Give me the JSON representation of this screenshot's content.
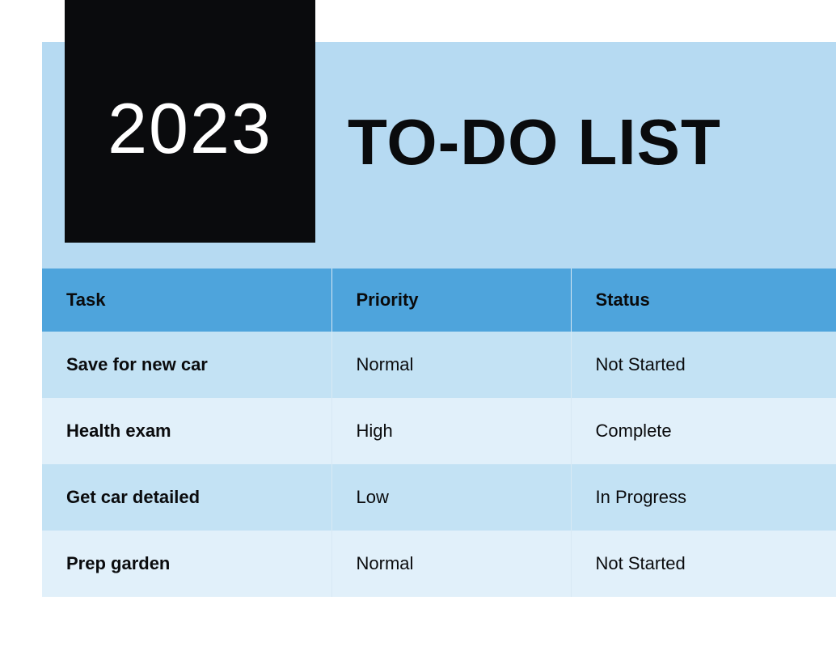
{
  "header": {
    "year": "2023",
    "title": "TO-DO LIST"
  },
  "table": {
    "columns": {
      "task": "Task",
      "priority": "Priority",
      "status": "Status"
    },
    "rows": [
      {
        "task": "Save for new car",
        "priority": "Normal",
        "status": "Not Started"
      },
      {
        "task": "Health exam",
        "priority": "High",
        "status": "Complete"
      },
      {
        "task": "Get car detailed",
        "priority": "Low",
        "status": "In Progress"
      },
      {
        "task": "Prep garden",
        "priority": "Normal",
        "status": "Not Started"
      }
    ]
  }
}
